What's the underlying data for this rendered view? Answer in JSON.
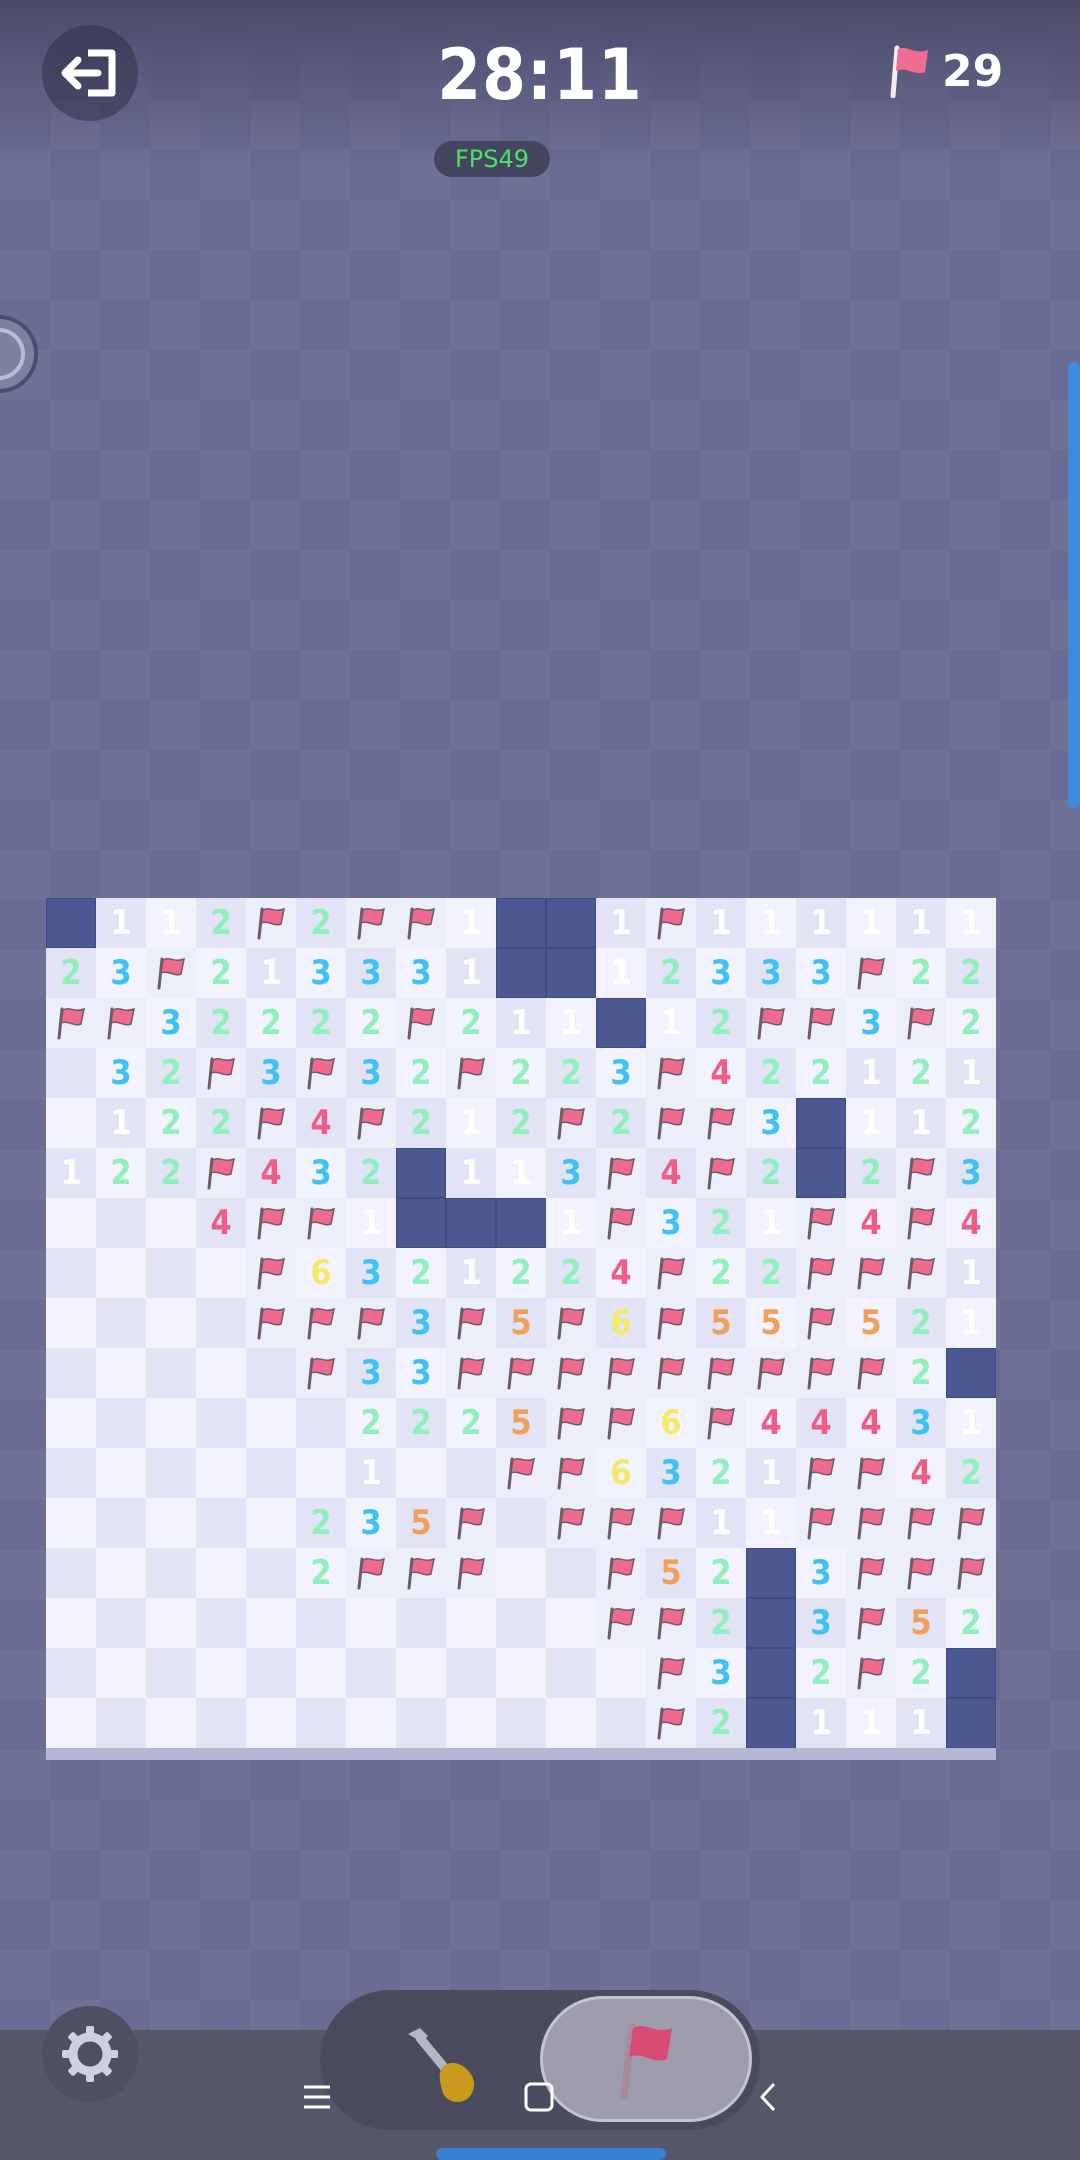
{
  "header": {
    "timer": "28:11",
    "flags_remaining": "29",
    "fps": "FPS49"
  },
  "icons": {
    "exit": "exit-icon",
    "flag": "flag-icon",
    "settings": "gear-icon",
    "dig": "shovel-icon",
    "menu": "menu-icon",
    "home": "home-icon",
    "back": "back-icon"
  },
  "colors": {
    "covered": "#4c5891",
    "open_light": "#f2f3fd",
    "open_dark": "#e2e4f6",
    "num1": "#ffffff",
    "num2": "#8ff0bd",
    "num3": "#3ec2f5",
    "num4": "#ef5d87",
    "num5": "#f1a05c",
    "num6": "#f3ea6a",
    "flag": "#ee6b8f"
  },
  "board": {
    "cols": 19,
    "rows": [
      "#112F2FF1##1F111111",
      "23F213331##12333F22F",
      "FF32222F211#12FF3F21",
      ".32F3F32F223F422121",
      ".122F4F212F2FF3#112F",
      "122F432#113F4F2#2F31",
      "...4FF1###1F321F4F41",
      "....F6321224F22FFF1",
      "....FFF3F5F6F55F521",
      ".....F33FFFFFFFFF2##",
      "......2225FF6F4443 1#",
      "......1..FF6321FF42",
      ".....235F.FFF11FFFF",
      ".....2FFF..F52#3FFF",
      "...........FF2#3F52",
      "............F3#2F2#",
      "............F2#111#"
    ]
  }
}
